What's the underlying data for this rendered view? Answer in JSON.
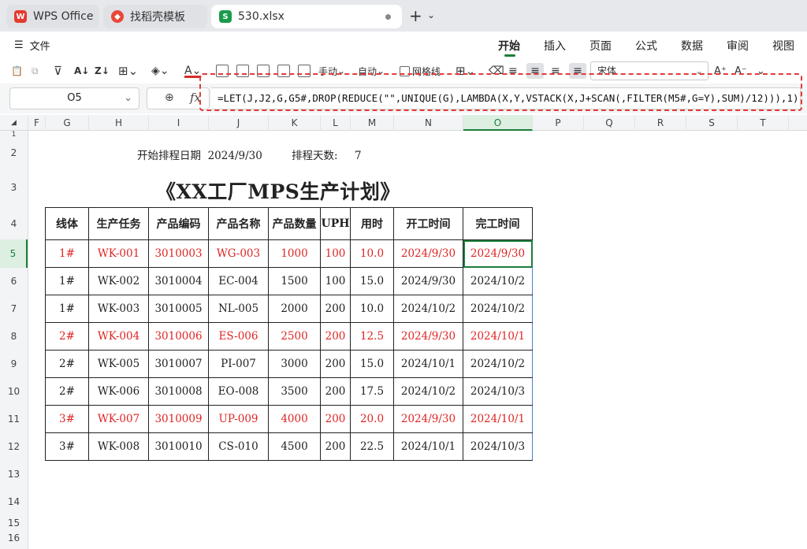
{
  "tabs": [
    {
      "label": "WPS Office",
      "icon": "wps-logo-icon"
    },
    {
      "label": "找稻壳模板",
      "icon": "docer-icon"
    },
    {
      "label": "530.xlsx",
      "icon": "spreadsheet-icon"
    }
  ],
  "menu": {
    "file_label": "文件",
    "ribbon_tabs": [
      "开始",
      "插入",
      "页面",
      "公式",
      "数据",
      "审阅",
      "视图"
    ],
    "active_tab": "开始"
  },
  "toolbar": {
    "manual_label": "手动",
    "auto_label": "自动",
    "gridlines_label": "网格线",
    "font_name": "宋体"
  },
  "formula_bar": {
    "cell_ref": "O5",
    "fx_label": "fx",
    "formula": "=LET(J,J2,G,G5#,DROP(REDUCE(\"\",UNIQUE(G),LAMBDA(X,Y,VSTACK(X,J+SCAN(,FILTER(M5#,G=Y),SUM)/12))),1))"
  },
  "columns": [
    "F",
    "G",
    "H",
    "I",
    "J",
    "K",
    "L",
    "M",
    "N",
    "O",
    "P",
    "Q",
    "R",
    "S",
    "T"
  ],
  "selected_column": "O",
  "rows": [
    "1",
    "2",
    "3",
    "4",
    "5",
    "6",
    "7",
    "8",
    "9",
    "10",
    "11",
    "12",
    "13",
    "14",
    "15",
    "16"
  ],
  "selected_row": "5",
  "sheet": {
    "start_label": "开始排程日期",
    "start_date": "2024/9/30",
    "days_label": "排程天数:",
    "days_value": "7",
    "title": "《XX工厂MPS生产计划》",
    "headers": [
      "线体",
      "生产任务",
      "产品编码",
      "产品名称",
      "产品数量",
      "UPH",
      "用时",
      "开工时间",
      "完工时间"
    ],
    "data": [
      {
        "red": true,
        "cells": [
          "1#",
          "WK-001",
          "3010003",
          "WG-003",
          "1000",
          "100",
          "10.0",
          "2024/9/30",
          "2024/9/30"
        ]
      },
      {
        "red": false,
        "cells": [
          "1#",
          "WK-002",
          "3010004",
          "EC-004",
          "1500",
          "100",
          "15.0",
          "2024/9/30",
          "2024/10/2"
        ]
      },
      {
        "red": false,
        "cells": [
          "1#",
          "WK-003",
          "3010005",
          "NL-005",
          "2000",
          "200",
          "10.0",
          "2024/10/2",
          "2024/10/2"
        ]
      },
      {
        "red": true,
        "cells": [
          "2#",
          "WK-004",
          "3010006",
          "ES-006",
          "2500",
          "200",
          "12.5",
          "2024/9/30",
          "2024/10/1"
        ]
      },
      {
        "red": false,
        "cells": [
          "2#",
          "WK-005",
          "3010007",
          "PI-007",
          "3000",
          "200",
          "15.0",
          "2024/10/1",
          "2024/10/2"
        ]
      },
      {
        "red": false,
        "cells": [
          "2#",
          "WK-006",
          "3010008",
          "EO-008",
          "3500",
          "200",
          "17.5",
          "2024/10/2",
          "2024/10/3"
        ]
      },
      {
        "red": true,
        "cells": [
          "3#",
          "WK-007",
          "3010009",
          "UP-009",
          "4000",
          "200",
          "20.0",
          "2024/9/30",
          "2024/10/1"
        ]
      },
      {
        "red": false,
        "cells": [
          "3#",
          "WK-008",
          "3010010",
          "CS-010",
          "4500",
          "200",
          "22.5",
          "2024/10/1",
          "2024/10/3"
        ]
      }
    ]
  },
  "colors": {
    "accent_green": "#1a7f3c",
    "highlight_red": "#e23b3b",
    "data_red": "#e02424"
  }
}
